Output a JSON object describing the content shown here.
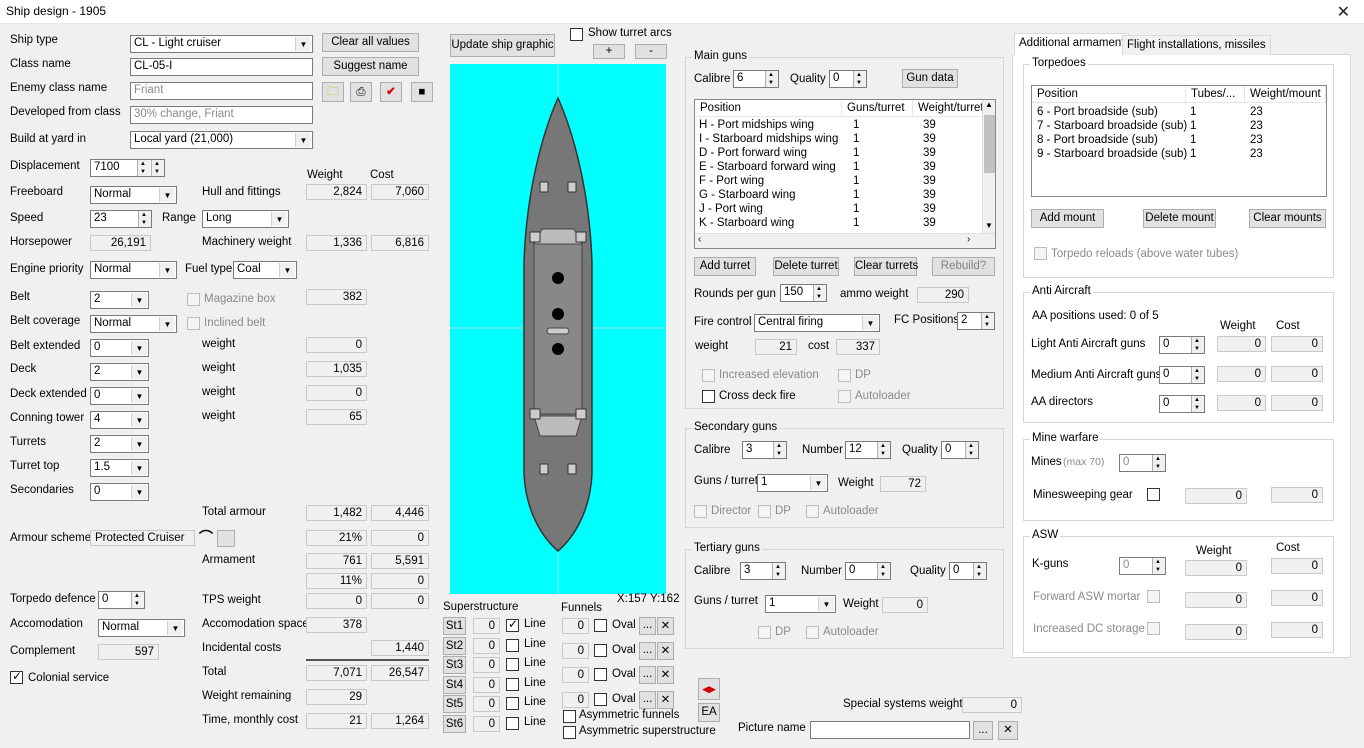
{
  "window": {
    "title": "Ship design - 1905",
    "close": "✕"
  },
  "left": {
    "ship_type_label": "Ship type",
    "ship_type": "CL - Light cruiser",
    "clear_all": "Clear all values",
    "class_name_label": "Class name",
    "class_name": "CL-05-I",
    "suggest_name": "Suggest name",
    "enemy_class_label": "Enemy class name",
    "enemy_class": "Friant",
    "developed_label": "Developed from class",
    "developed_placeholder": "30% change, Friant",
    "build_yard_label": "Build at yard in",
    "build_yard": "Local yard (21,000)",
    "displacement_label": "Displacement",
    "displacement": "7100",
    "weight_hdr": "Weight",
    "cost_hdr": "Cost",
    "freeboard_label": "Freeboard",
    "freeboard": "Normal",
    "hull_label": "Hull and fittings",
    "hull_weight": "2,824",
    "hull_cost": "7,060",
    "speed_label": "Speed",
    "speed": "23",
    "range_label": "Range",
    "range": "Long",
    "hp_label": "Horsepower",
    "hp": "26,191",
    "mach_label": "Machinery weight",
    "mach_weight": "1,336",
    "mach_cost": "6,816",
    "engine_label": "Engine priority",
    "engine": "Normal",
    "fuel_label": "Fuel type",
    "fuel": "Coal",
    "belt_label": "Belt",
    "belt": "2",
    "magazine_label": "Magazine box",
    "magazine_value": "382",
    "belt_cov_label": "Belt coverage",
    "belt_cov": "Normal",
    "inclined_label": "Inclined belt",
    "belt_ext_label": "Belt extended",
    "belt_ext": "0",
    "w1_label": "weight",
    "w1": "0",
    "deck_label": "Deck",
    "deck": "2",
    "w2_label": "weight",
    "w2": "1,035",
    "deck_ext_label": "Deck extended",
    "deck_ext": "0",
    "w3_label": "weight",
    "w3": "0",
    "conning_label": "Conning tower",
    "conning": "4",
    "w4_label": "weight",
    "w4": "65",
    "turrets_label": "Turrets",
    "turrets": "2",
    "turret_top_label": "Turret top",
    "turret_top": "1.5",
    "secondaries_label": "Secondaries",
    "secondaries": "0",
    "total_armour_label": "Total armour",
    "total_armour_w": "1,482",
    "total_armour_c": "4,446",
    "armour_scheme_label": "Armour scheme",
    "armour_scheme": "Protected Cruiser",
    "armour_pct": "21%",
    "armour_pct_c": "0",
    "armament_label": "Armament",
    "armament_w": "761",
    "armament_c": "5,591",
    "armament_pct": "11%",
    "armament_pct_c": "0",
    "torp_def_label": "Torpedo defence",
    "torp_def": "0",
    "tps_label": "TPS weight",
    "tps_w": "0",
    "tps_c": "0",
    "accom_label": "Accomodation",
    "accom": "Normal",
    "accom_space_label": "Accomodation space",
    "accom_space": "378",
    "complement_label": "Complement",
    "complement": "597",
    "incidental_label": "Incidental costs",
    "incidental": "1,440",
    "colonial_label": "Colonial service",
    "total_label": "Total",
    "total_w": "7,071",
    "total_c": "26,547",
    "remaining_label": "Weight remaining",
    "remaining": "29",
    "time_label": "Time, monthly cost",
    "time": "21",
    "monthly": "1,264"
  },
  "graphic": {
    "update": "Update ship graphic",
    "show_arcs": "Show turret arcs",
    "plus": "+",
    "minus": "-",
    "coords": "X:157 Y:162",
    "superstructure": "Superstructure",
    "funnels": "Funnels",
    "st": [
      {
        "l": "St1",
        "v": "0",
        "line": true
      },
      {
        "l": "St2",
        "v": "0",
        "line": false
      },
      {
        "l": "St3",
        "v": "0",
        "line": false
      },
      {
        "l": "St4",
        "v": "0",
        "line": false
      },
      {
        "l": "St5",
        "v": "0",
        "line": false
      },
      {
        "l": "St6",
        "v": "0",
        "line": false
      }
    ],
    "line_label": "Line",
    "oval_label": "Oval",
    "fun_val": "0",
    "dots": "...",
    "x": "✕",
    "asym_funnels": "Asymmetric funnels",
    "asym_super": "Asymmetric superstructure",
    "ea": "EA",
    "water_color": "#00ffff",
    "hull_color": "#777777"
  },
  "main_guns": {
    "title": "Main guns",
    "calibre_label": "Calibre",
    "calibre": "6",
    "quality_label": "Quality",
    "quality": "0",
    "gun_data": "Gun data",
    "cols": [
      "Position",
      "Guns/turret",
      "Weight/turret"
    ],
    "rows": [
      [
        "H - Port midships wing",
        "1",
        "39"
      ],
      [
        "I - Starboard midships wing",
        "1",
        "39"
      ],
      [
        "D - Port forward wing",
        "1",
        "39"
      ],
      [
        "E - Starboard forward wing",
        "1",
        "39"
      ],
      [
        "F - Port wing",
        "1",
        "39"
      ],
      [
        "G - Starboard wing",
        "1",
        "39"
      ],
      [
        "J - Port wing",
        "1",
        "39"
      ],
      [
        "K - Starboard wing",
        "1",
        "39"
      ]
    ],
    "add": "Add turret",
    "delete": "Delete turret",
    "clear": "Clear turrets",
    "rebuild": "Rebuild?",
    "rounds_label": "Rounds per gun",
    "rounds": "150",
    "ammo_label": "ammo weight",
    "ammo": "290",
    "fire_label": "Fire control",
    "fire": "Central firing",
    "fc_label": "FC Positions",
    "fc": "2",
    "weight_label": "weight",
    "weight": "21",
    "cost_label": "cost",
    "cost": "337",
    "inc_elev": "Increased elevation",
    "dp": "DP",
    "cross_deck": "Cross deck fire",
    "autoloader": "Autoloader"
  },
  "secondary": {
    "title": "Secondary guns",
    "calibre_label": "Calibre",
    "calibre": "3",
    "number_label": "Number",
    "number": "12",
    "quality_label": "Quality",
    "quality": "0",
    "gpt_label": "Guns / turret",
    "gpt": "1",
    "weight_label": "Weight",
    "weight": "72",
    "director": "Director",
    "dp": "DP",
    "autoloader": "Autoloader"
  },
  "tertiary": {
    "title": "Tertiary guns",
    "calibre_label": "Calibre",
    "calibre": "3",
    "number_label": "Number",
    "number": "0",
    "quality_label": "Quality",
    "quality": "0",
    "gpt_label": "Guns / turret",
    "gpt": "1",
    "weight_label": "Weight",
    "weight": "0",
    "dp": "DP",
    "autoloader": "Autoloader"
  },
  "bottom": {
    "special_label": "Special systems weight",
    "special": "0",
    "picture_label": "Picture name",
    "dots": "...",
    "x": "✕"
  },
  "tabs": {
    "additional": "Additional armament",
    "flight": "Flight installations, missiles"
  },
  "torpedoes": {
    "title": "Torpedoes",
    "cols": [
      "Position",
      "Tubes/...",
      "Weight/mount"
    ],
    "rows": [
      [
        "6 - Port broadside (sub)",
        "1",
        "23"
      ],
      [
        "7 - Starboard broadside (sub)",
        "1",
        "23"
      ],
      [
        "8 - Port broadside (sub)",
        "1",
        "23"
      ],
      [
        "9 - Starboard broadside (sub)",
        "1",
        "23"
      ]
    ],
    "add": "Add mount",
    "delete": "Delete mount",
    "clear": "Clear mounts",
    "reloads": "Torpedo reloads (above water tubes)"
  },
  "aa": {
    "title": "Anti Aircraft",
    "used": "AA positions used: 0 of 5",
    "weight_hdr": "Weight",
    "cost_hdr": "Cost",
    "light_label": "Light Anti Aircraft guns",
    "light": "0",
    "light_w": "0",
    "light_c": "0",
    "medium_label": "Medium Anti Aircraft guns",
    "medium": "0",
    "medium_w": "0",
    "medium_c": "0",
    "dir_label": "AA directors",
    "dir": "0",
    "dir_w": "0",
    "dir_c": "0"
  },
  "mine": {
    "title": "Mine warfare",
    "mines_label": "Mines",
    "mines_max": "(max 70)",
    "mines": "0",
    "sweep_label": "Minesweeping gear",
    "sweep_w": "0",
    "sweep_c": "0"
  },
  "asw": {
    "title": "ASW",
    "weight_hdr": "Weight",
    "cost_hdr": "Cost",
    "kguns_label": "K-guns",
    "kguns": "0",
    "kguns_w": "0",
    "kguns_c": "0",
    "mortar_label": "Forward ASW mortar",
    "mortar_w": "0",
    "mortar_c": "0",
    "dc_label": "Increased DC storage",
    "dc_w": "0",
    "dc_c": "0"
  }
}
